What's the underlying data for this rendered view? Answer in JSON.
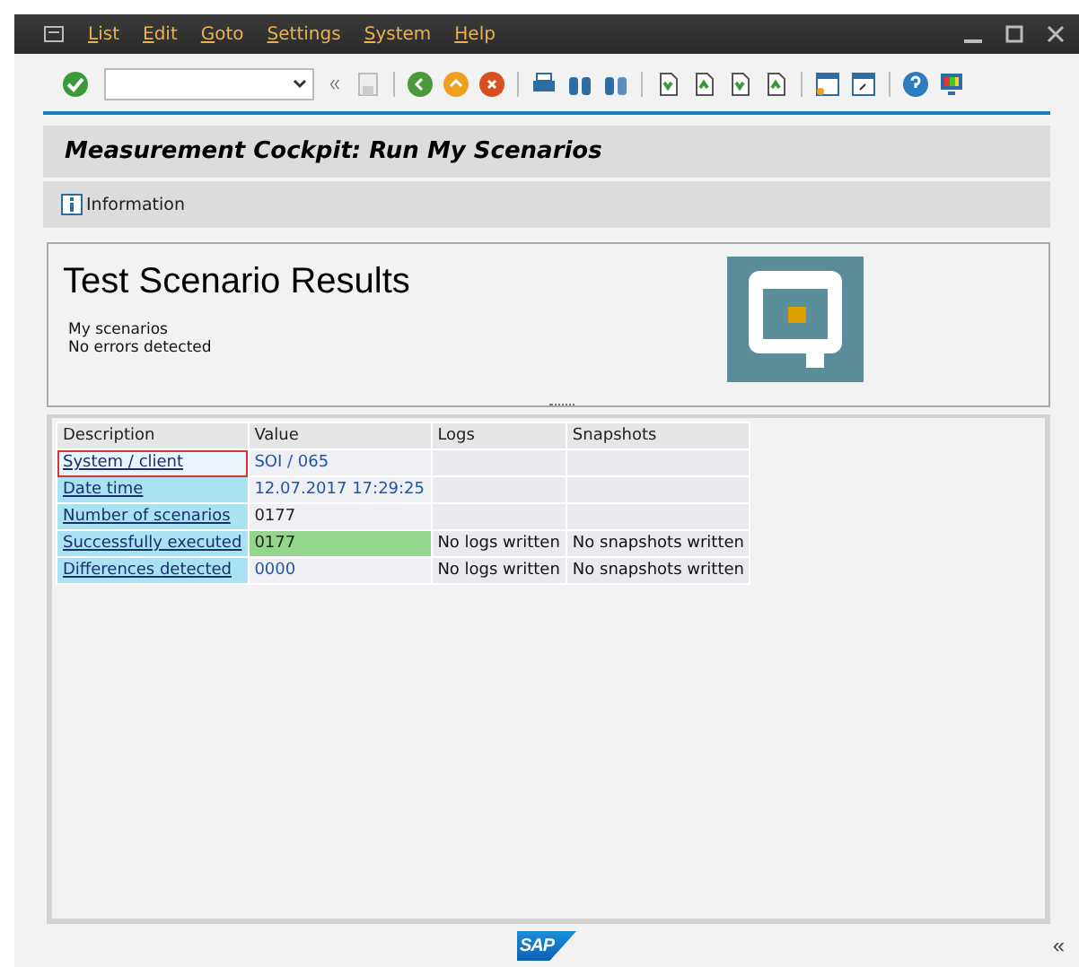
{
  "menu": [
    {
      "label": "List"
    },
    {
      "label": "Edit"
    },
    {
      "label": "Goto"
    },
    {
      "label": "Settings"
    },
    {
      "label": "System"
    },
    {
      "label": "Help"
    }
  ],
  "title": "Measurement Cockpit: Run My Scenarios",
  "app_toolbar": [
    {
      "label": "Information"
    }
  ],
  "header": {
    "heading": "Test Scenario Results",
    "lines": [
      "My scenarios",
      "No errors detected"
    ]
  },
  "table": {
    "columns": [
      "Description",
      "Value",
      "Logs",
      "Snapshots"
    ],
    "rows": [
      {
        "description": "System / client",
        "value": "SOI / 065",
        "selected": true,
        "highlighted": false,
        "kind": "info"
      },
      {
        "description": "Date time",
        "value": "12.07.2017 17:29:25",
        "selected": false,
        "highlighted": false,
        "kind": "info"
      },
      {
        "description": "Number of scenarios",
        "value": "0177",
        "selected": false,
        "highlighted": false,
        "kind": "count"
      },
      {
        "description": "Successfully executed",
        "value": "0177",
        "logs": "No logs written",
        "snapshots": "No snapshots written",
        "selected": false,
        "highlighted": true,
        "kind": "count"
      },
      {
        "description": "Differences detected",
        "value": "0000",
        "logs": "No logs written",
        "snapshots": "No snapshots written",
        "selected": false,
        "highlighted": false,
        "kind": "info"
      }
    ]
  },
  "footer": {
    "logo": "SAP",
    "collapse": "«"
  }
}
